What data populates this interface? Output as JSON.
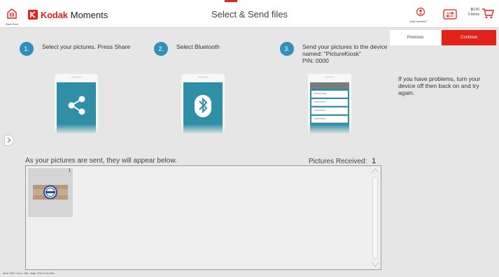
{
  "header": {
    "start_over_label": "Start Over",
    "brand_name_bold": "Kodak",
    "brand_name_rest": "Moments",
    "title": "Select & Send files",
    "help_label": "Help needed?",
    "cart_amount": "$0.00",
    "cart_items": "0 items",
    "accent_color": "#e2231a"
  },
  "nav": {
    "previous_label": "Previous",
    "continue_label": "Continue"
  },
  "steps": [
    {
      "number": "1.",
      "text": "Select your pictures. Press Share",
      "icon": "share-icon"
    },
    {
      "number": "2.",
      "text": "Select Bluetooth",
      "icon": "bluetooth-icon"
    },
    {
      "number": "3.",
      "text_line1": "Send your pictures to the device",
      "text_line2": "named: \"PictureKiosk\"",
      "text_line3": "PIN: 0000",
      "phone_list_label": "Picture Kiosk"
    }
  ],
  "help_text": "If you have problems, turn your device off then back on and try again.",
  "transfer": {
    "sent_caption": "As your pictures are sent, they will appear below.",
    "received_label": "Pictures Received:",
    "received_count": "1",
    "thumbnails": [
      {
        "index": "1"
      }
    ]
  },
  "footer": {
    "build_info": "W10: HPK+ V12.1.7/55 - Build: 2022.04.8.2254"
  }
}
